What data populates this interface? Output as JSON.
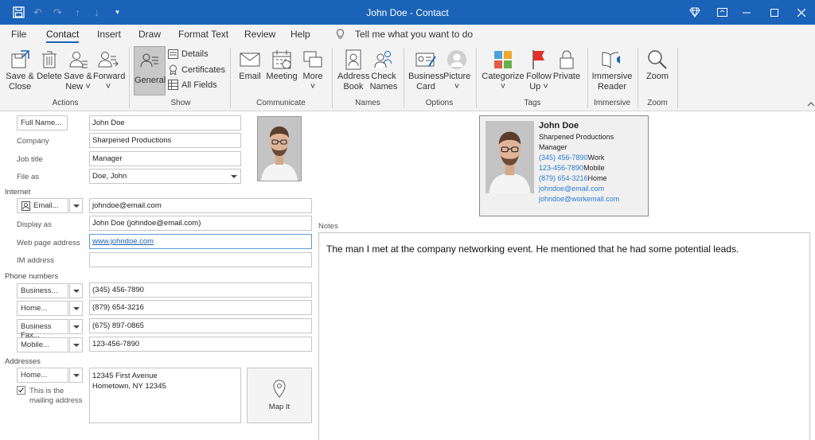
{
  "window": {
    "title": "John Doe  -  Contact"
  },
  "tabs": [
    {
      "label": "File"
    },
    {
      "label": "Contact"
    },
    {
      "label": "Insert"
    },
    {
      "label": "Draw"
    },
    {
      "label": "Format Text"
    },
    {
      "label": "Review"
    },
    {
      "label": "Help"
    }
  ],
  "tell_me": "Tell me what you want to do",
  "ribbon": {
    "save_close": "Save &\nClose",
    "delete": "Delete",
    "save_new": "Save &\nNew",
    "forward": "Forward",
    "general": "General",
    "details": "Details",
    "certificates": "Certificates",
    "all_fields": "All Fields",
    "email": "Email",
    "meeting": "Meeting",
    "more": "More",
    "address_book": "Address\nBook",
    "check_names": "Check\nNames",
    "business_card": "Business\nCard",
    "picture": "Picture",
    "categorize": "Categorize",
    "follow_up": "Follow\nUp",
    "private": "Private",
    "immersive_reader": "Immersive\nReader",
    "zoom": "Zoom",
    "groups": {
      "actions": "Actions",
      "show": "Show",
      "communicate": "Communicate",
      "names": "Names",
      "options": "Options",
      "tags": "Tags",
      "immersive": "Immersive",
      "zoom": "Zoom"
    }
  },
  "form": {
    "full_name_btn": "Full Name...",
    "full_name": "John Doe",
    "company_label": "Company",
    "company": "Sharpened Productions",
    "job_title_label": "Job title",
    "job_title": "Manager",
    "file_as_label": "File as",
    "file_as": "Doe, John",
    "internet_section": "Internet",
    "email_btn": "Email...",
    "email": "johndoe@email.com",
    "display_as_label": "Display as",
    "display_as": "John Doe (johndoe@email.com)",
    "web_label": "Web page address",
    "web": "www.johndoe.com",
    "im_label": "IM address",
    "im": "",
    "phone_section": "Phone numbers",
    "phones": [
      {
        "type": "Business...",
        "value": "(345) 456-7890"
      },
      {
        "type": "Home...",
        "value": "(879) 654-3216"
      },
      {
        "type": "Business Fax...",
        "value": "(675) 897-0865"
      },
      {
        "type": "Mobile...",
        "value": "123-456-7890"
      }
    ],
    "addresses_section": "Addresses",
    "address_type": "Home...",
    "address_line1": "12345 First Avenue",
    "address_line2": "Hometown, NY  12345",
    "mailing_label_1": "This is the",
    "mailing_label_2": "mailing address",
    "map_it": "Map It"
  },
  "card": {
    "name": "John Doe",
    "company": "Sharpened Productions",
    "title": "Manager",
    "lines": [
      {
        "value": "(345) 456-7890",
        "tag": "Work"
      },
      {
        "value": "123-456-7890",
        "tag": "Mobile"
      },
      {
        "value": "(879) 654-3216",
        "tag": "Home"
      }
    ],
    "email1": "johndoe@email.com",
    "email2": "johndoe@workemail.com"
  },
  "notes": {
    "label": "Notes",
    "text": "The man I met at the company networking event. He mentioned that he had some potential leads."
  },
  "colors": {
    "accent": "#1b63b8",
    "link": "#2b7cd3"
  }
}
